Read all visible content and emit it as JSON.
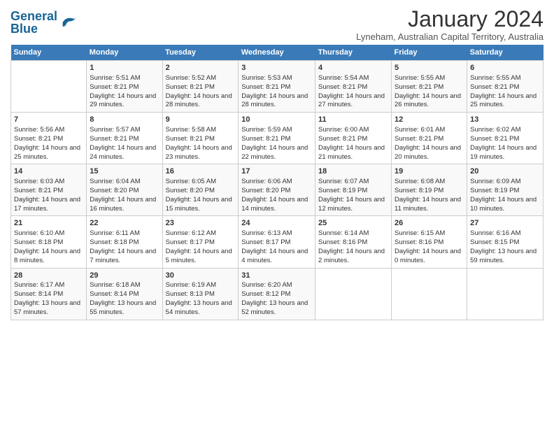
{
  "header": {
    "logo_text1": "General",
    "logo_text2": "Blue",
    "month_title": "January 2024",
    "location": "Lyneham, Australian Capital Territory, Australia"
  },
  "days_of_week": [
    "Sunday",
    "Monday",
    "Tuesday",
    "Wednesday",
    "Thursday",
    "Friday",
    "Saturday"
  ],
  "weeks": [
    [
      {
        "day": "",
        "sunrise": "",
        "sunset": "",
        "daylight": ""
      },
      {
        "day": "1",
        "sunrise": "Sunrise: 5:51 AM",
        "sunset": "Sunset: 8:21 PM",
        "daylight": "Daylight: 14 hours and 29 minutes."
      },
      {
        "day": "2",
        "sunrise": "Sunrise: 5:52 AM",
        "sunset": "Sunset: 8:21 PM",
        "daylight": "Daylight: 14 hours and 28 minutes."
      },
      {
        "day": "3",
        "sunrise": "Sunrise: 5:53 AM",
        "sunset": "Sunset: 8:21 PM",
        "daylight": "Daylight: 14 hours and 28 minutes."
      },
      {
        "day": "4",
        "sunrise": "Sunrise: 5:54 AM",
        "sunset": "Sunset: 8:21 PM",
        "daylight": "Daylight: 14 hours and 27 minutes."
      },
      {
        "day": "5",
        "sunrise": "Sunrise: 5:55 AM",
        "sunset": "Sunset: 8:21 PM",
        "daylight": "Daylight: 14 hours and 26 minutes."
      },
      {
        "day": "6",
        "sunrise": "Sunrise: 5:55 AM",
        "sunset": "Sunset: 8:21 PM",
        "daylight": "Daylight: 14 hours and 25 minutes."
      }
    ],
    [
      {
        "day": "7",
        "sunrise": "Sunrise: 5:56 AM",
        "sunset": "Sunset: 8:21 PM",
        "daylight": "Daylight: 14 hours and 25 minutes."
      },
      {
        "day": "8",
        "sunrise": "Sunrise: 5:57 AM",
        "sunset": "Sunset: 8:21 PM",
        "daylight": "Daylight: 14 hours and 24 minutes."
      },
      {
        "day": "9",
        "sunrise": "Sunrise: 5:58 AM",
        "sunset": "Sunset: 8:21 PM",
        "daylight": "Daylight: 14 hours and 23 minutes."
      },
      {
        "day": "10",
        "sunrise": "Sunrise: 5:59 AM",
        "sunset": "Sunset: 8:21 PM",
        "daylight": "Daylight: 14 hours and 22 minutes."
      },
      {
        "day": "11",
        "sunrise": "Sunrise: 6:00 AM",
        "sunset": "Sunset: 8:21 PM",
        "daylight": "Daylight: 14 hours and 21 minutes."
      },
      {
        "day": "12",
        "sunrise": "Sunrise: 6:01 AM",
        "sunset": "Sunset: 8:21 PM",
        "daylight": "Daylight: 14 hours and 20 minutes."
      },
      {
        "day": "13",
        "sunrise": "Sunrise: 6:02 AM",
        "sunset": "Sunset: 8:21 PM",
        "daylight": "Daylight: 14 hours and 19 minutes."
      }
    ],
    [
      {
        "day": "14",
        "sunrise": "Sunrise: 6:03 AM",
        "sunset": "Sunset: 8:21 PM",
        "daylight": "Daylight: 14 hours and 17 minutes."
      },
      {
        "day": "15",
        "sunrise": "Sunrise: 6:04 AM",
        "sunset": "Sunset: 8:20 PM",
        "daylight": "Daylight: 14 hours and 16 minutes."
      },
      {
        "day": "16",
        "sunrise": "Sunrise: 6:05 AM",
        "sunset": "Sunset: 8:20 PM",
        "daylight": "Daylight: 14 hours and 15 minutes."
      },
      {
        "day": "17",
        "sunrise": "Sunrise: 6:06 AM",
        "sunset": "Sunset: 8:20 PM",
        "daylight": "Daylight: 14 hours and 14 minutes."
      },
      {
        "day": "18",
        "sunrise": "Sunrise: 6:07 AM",
        "sunset": "Sunset: 8:19 PM",
        "daylight": "Daylight: 14 hours and 12 minutes."
      },
      {
        "day": "19",
        "sunrise": "Sunrise: 6:08 AM",
        "sunset": "Sunset: 8:19 PM",
        "daylight": "Daylight: 14 hours and 11 minutes."
      },
      {
        "day": "20",
        "sunrise": "Sunrise: 6:09 AM",
        "sunset": "Sunset: 8:19 PM",
        "daylight": "Daylight: 14 hours and 10 minutes."
      }
    ],
    [
      {
        "day": "21",
        "sunrise": "Sunrise: 6:10 AM",
        "sunset": "Sunset: 8:18 PM",
        "daylight": "Daylight: 14 hours and 8 minutes."
      },
      {
        "day": "22",
        "sunrise": "Sunrise: 6:11 AM",
        "sunset": "Sunset: 8:18 PM",
        "daylight": "Daylight: 14 hours and 7 minutes."
      },
      {
        "day": "23",
        "sunrise": "Sunrise: 6:12 AM",
        "sunset": "Sunset: 8:17 PM",
        "daylight": "Daylight: 14 hours and 5 minutes."
      },
      {
        "day": "24",
        "sunrise": "Sunrise: 6:13 AM",
        "sunset": "Sunset: 8:17 PM",
        "daylight": "Daylight: 14 hours and 4 minutes."
      },
      {
        "day": "25",
        "sunrise": "Sunrise: 6:14 AM",
        "sunset": "Sunset: 8:16 PM",
        "daylight": "Daylight: 14 hours and 2 minutes."
      },
      {
        "day": "26",
        "sunrise": "Sunrise: 6:15 AM",
        "sunset": "Sunset: 8:16 PM",
        "daylight": "Daylight: 14 hours and 0 minutes."
      },
      {
        "day": "27",
        "sunrise": "Sunrise: 6:16 AM",
        "sunset": "Sunset: 8:15 PM",
        "daylight": "Daylight: 13 hours and 59 minutes."
      }
    ],
    [
      {
        "day": "28",
        "sunrise": "Sunrise: 6:17 AM",
        "sunset": "Sunset: 8:14 PM",
        "daylight": "Daylight: 13 hours and 57 minutes."
      },
      {
        "day": "29",
        "sunrise": "Sunrise: 6:18 AM",
        "sunset": "Sunset: 8:14 PM",
        "daylight": "Daylight: 13 hours and 55 minutes."
      },
      {
        "day": "30",
        "sunrise": "Sunrise: 6:19 AM",
        "sunset": "Sunset: 8:13 PM",
        "daylight": "Daylight: 13 hours and 54 minutes."
      },
      {
        "day": "31",
        "sunrise": "Sunrise: 6:20 AM",
        "sunset": "Sunset: 8:12 PM",
        "daylight": "Daylight: 13 hours and 52 minutes."
      },
      {
        "day": "",
        "sunrise": "",
        "sunset": "",
        "daylight": ""
      },
      {
        "day": "",
        "sunrise": "",
        "sunset": "",
        "daylight": ""
      },
      {
        "day": "",
        "sunrise": "",
        "sunset": "",
        "daylight": ""
      }
    ]
  ]
}
